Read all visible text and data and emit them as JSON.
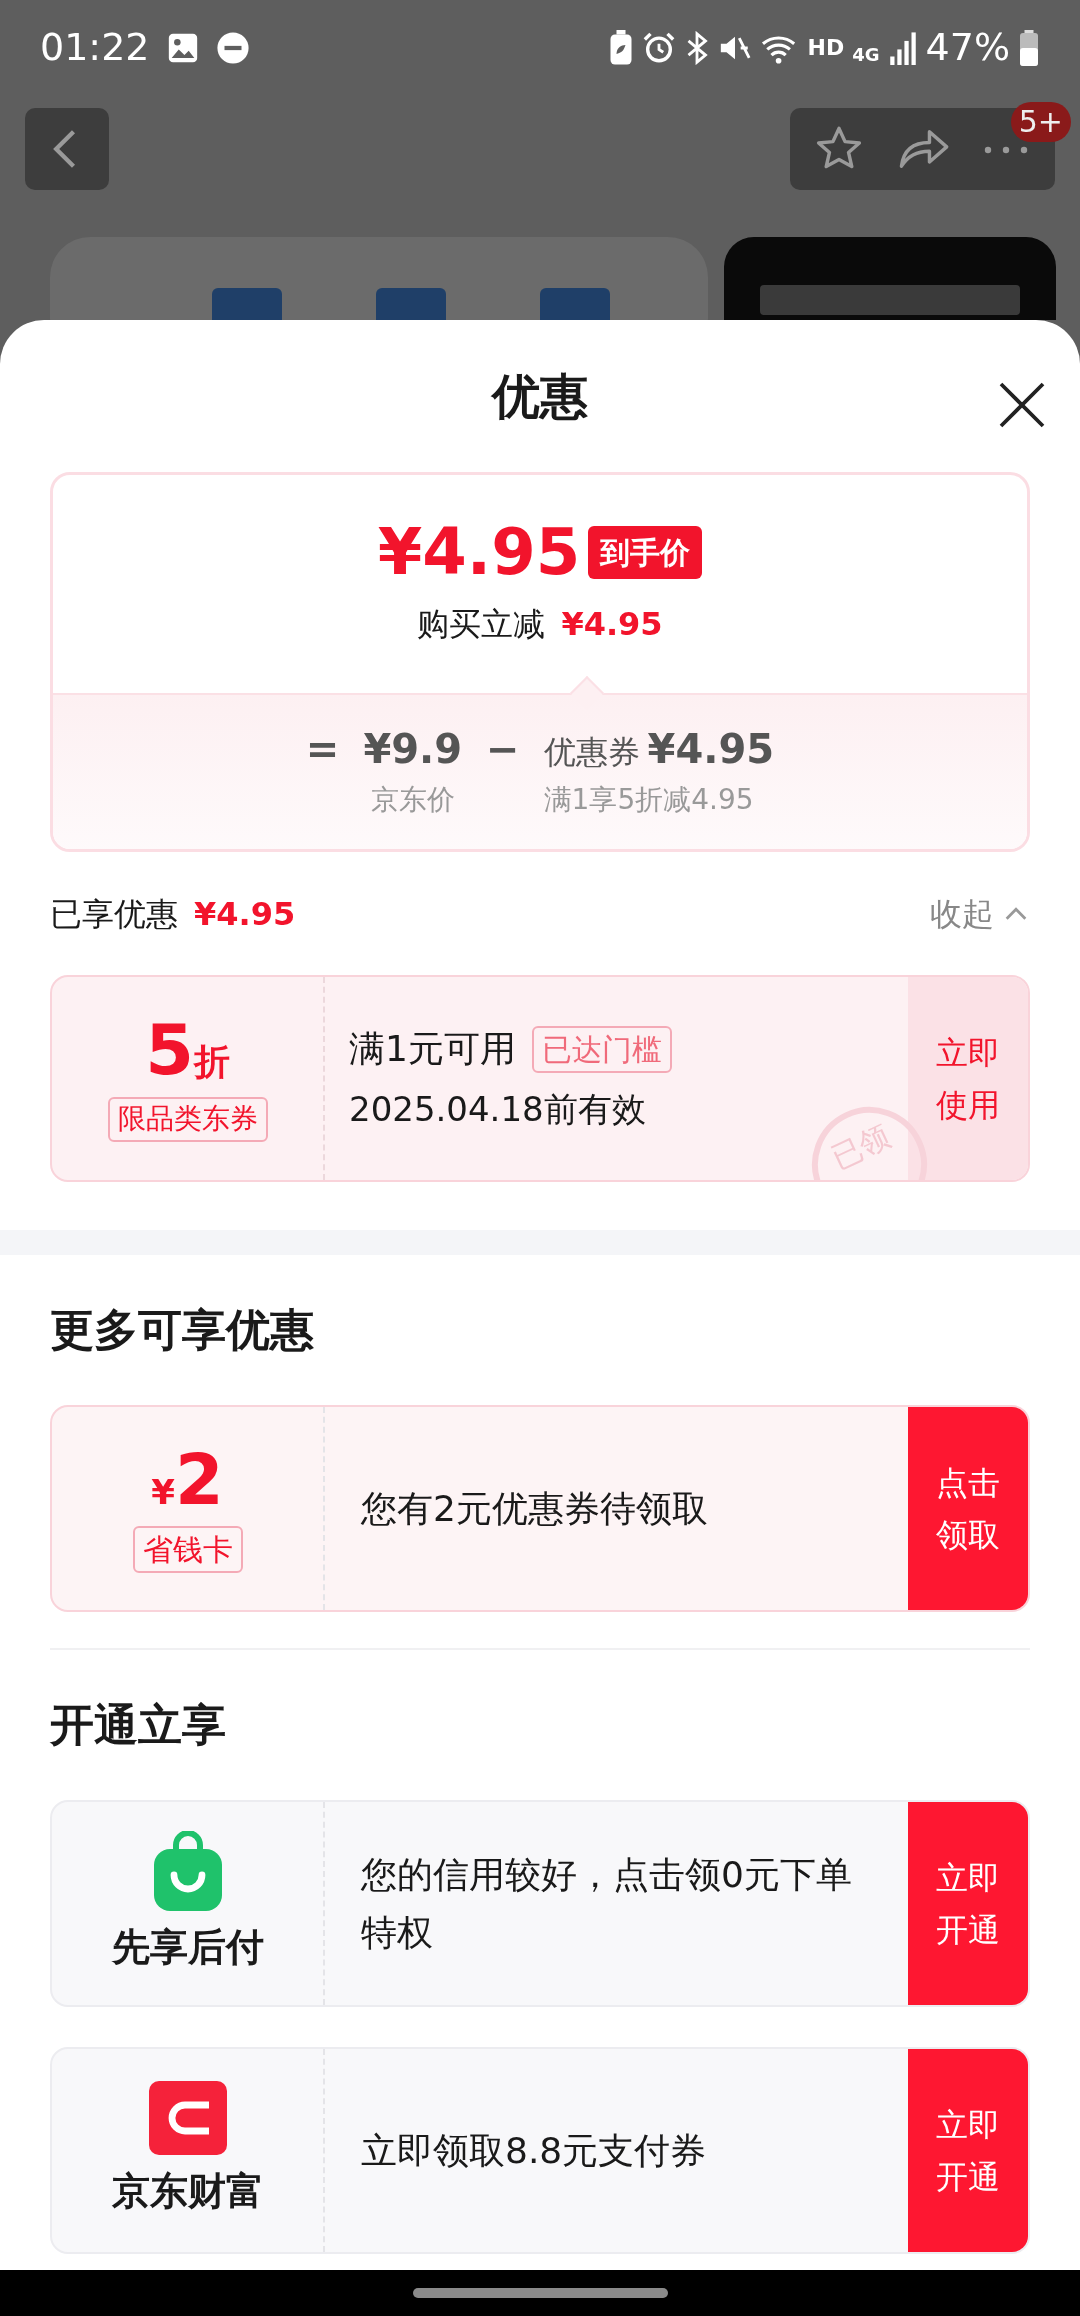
{
  "status_bar": {
    "time": "01:22",
    "network_labels": [
      "HD",
      "4G"
    ],
    "battery": "47%"
  },
  "top_bar": {
    "badge": "5+"
  },
  "sheet": {
    "title": "优惠"
  },
  "price_summary": {
    "final_price": "¥4.95",
    "final_tag": "到手价",
    "reduction_label": "购买立减",
    "reduction": "¥4.95",
    "equals": "=",
    "base_price": "¥9.9",
    "base_label": "京东价",
    "minus": "−",
    "coupon_label": "优惠券",
    "coupon_amount": "¥4.95",
    "coupon_rule": "满1享5折减4.95"
  },
  "applied": {
    "label": "已享优惠",
    "amount": "¥4.95",
    "toggle": "收起",
    "expanded": true,
    "coupons": [
      {
        "value": "5",
        "unit": "折",
        "tag": "限品类东券",
        "title": "满1元可用",
        "badge": "已达门槛",
        "subtitle": "2025.04.18前有效",
        "stamp": "已领",
        "action": "立即使用"
      }
    ]
  },
  "sections": [
    {
      "title": "更多可享优惠",
      "offers": [
        {
          "kind": "card",
          "currency": "¥",
          "value": "2",
          "tag": "省钱卡",
          "text": "您有2元优惠券待领取",
          "action": "点击领取"
        }
      ]
    },
    {
      "title": "开通立享",
      "offers": [
        {
          "kind": "bag",
          "name": "先享后付",
          "text": "您的信用较好，点击领0元下单特权",
          "action": "立即开通"
        },
        {
          "kind": "wallet",
          "name": "京东财富",
          "text": "立即领取8.8元支付券",
          "action": "立即开通"
        }
      ]
    }
  ]
}
